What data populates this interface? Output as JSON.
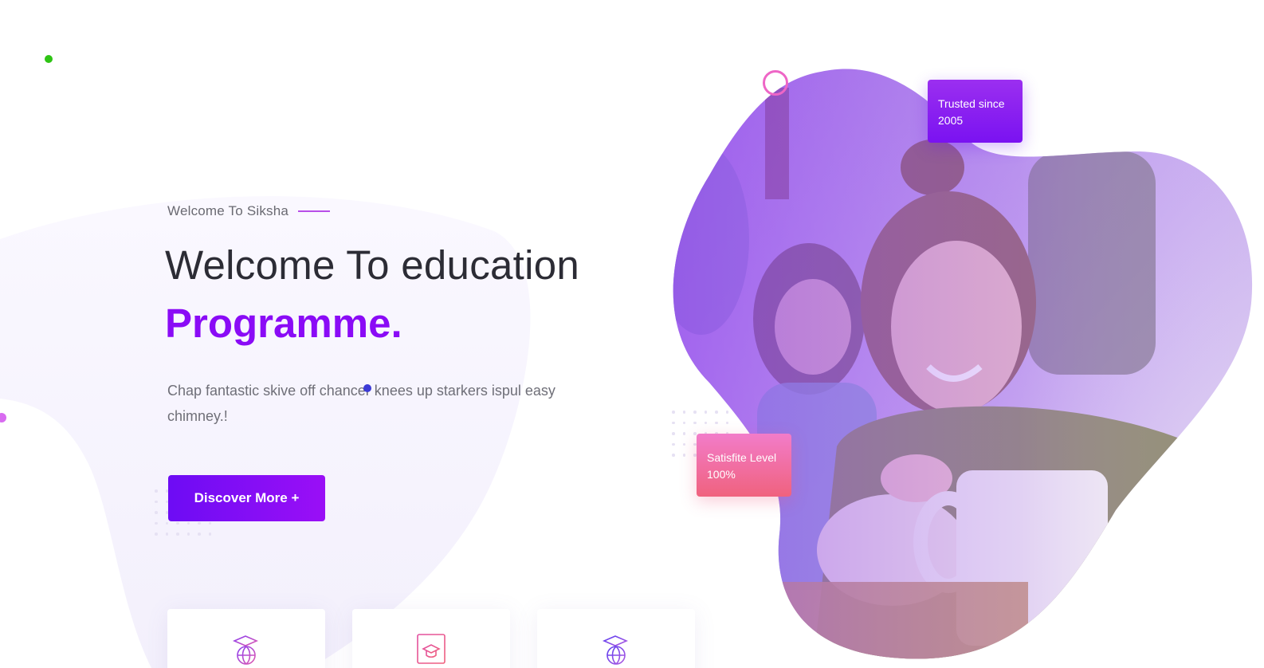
{
  "hero": {
    "eyebrow": "Welcome To Siksha",
    "title_line1": "Welcome To education",
    "title_line2": "Programme.",
    "lead": "Chap fantastic skive off chancer knees up starkers ispul easy chimney.!",
    "cta_label": "Discover More +"
  },
  "badges": {
    "trusted": {
      "line1": "Trusted since",
      "line2": "2005"
    },
    "satisfaction": {
      "line1": "Satisfite Level",
      "line2": "100%"
    }
  },
  "feature_cards": [
    {
      "icon": "graduation-globe-icon"
    },
    {
      "icon": "graduation-book-icon"
    },
    {
      "icon": "graduation-globe-icon"
    }
  ],
  "colors": {
    "accent_purple": "#8a0bf6",
    "button_gradient_start": "#6d0cf4",
    "button_gradient_end": "#9a0ff6",
    "badge_pink": "#f0627e",
    "heading_text": "#2c2c35",
    "body_text": "#6f6f78"
  }
}
